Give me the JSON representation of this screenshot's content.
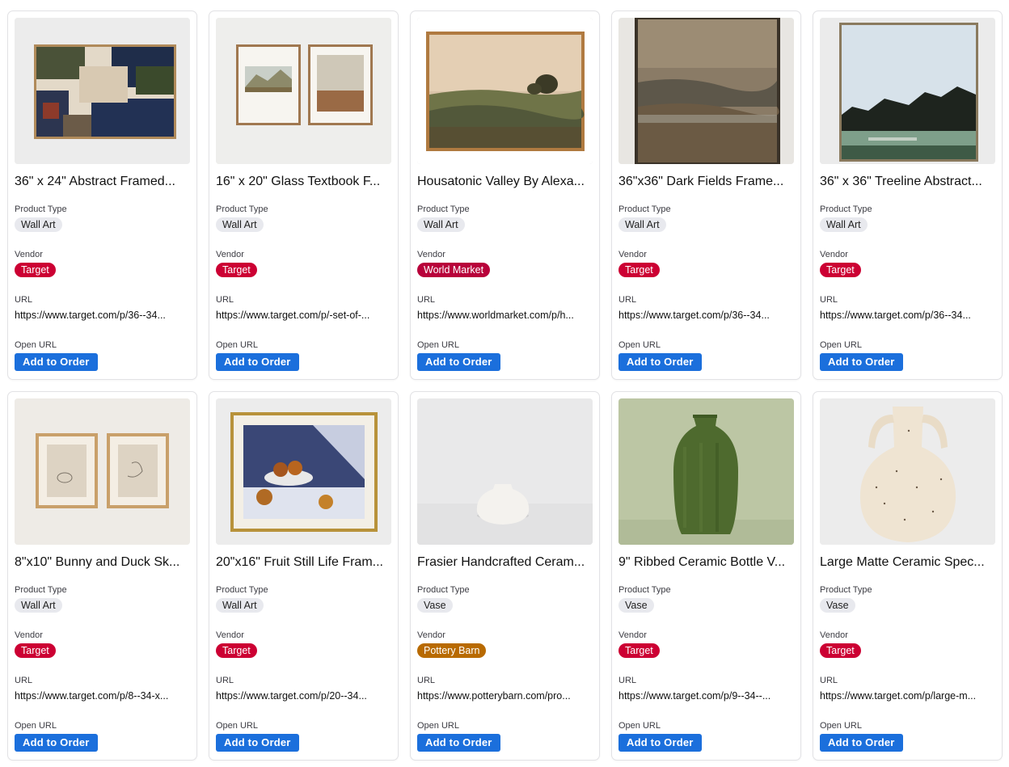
{
  "labels": {
    "product_type": "Product Type",
    "vendor": "Vendor",
    "url": "URL",
    "open_url": "Open URL",
    "add_to_order": "Add to Order"
  },
  "colors": {
    "Target": "#cc0033",
    "World Market": "#b8003a",
    "Pottery Barn": "#b86a00",
    "button": "#1b6fdc"
  },
  "products": [
    {
      "title": "36\" x 24\" Abstract Framed...",
      "type": "Wall Art",
      "vendor": "Target",
      "url": "https://www.target.com/p/36--34...",
      "image": "abstract-framed-art"
    },
    {
      "title": "16\" x 20\" Glass Textbook F...",
      "type": "Wall Art",
      "vendor": "Target",
      "url": "https://www.target.com/p/-set-of-...",
      "image": "two-framed-landscapes"
    },
    {
      "title": "Housatonic Valley By Alexa...",
      "type": "Wall Art",
      "vendor": "World Market",
      "url": "https://www.worldmarket.com/p/h...",
      "image": "landscape-painting"
    },
    {
      "title": "36\"x36\" Dark Fields Frame...",
      "type": "Wall Art",
      "vendor": "Target",
      "url": "https://www.target.com/p/36--34...",
      "image": "dark-fields-painting"
    },
    {
      "title": "36\" x 36\" Treeline Abstract...",
      "type": "Wall Art",
      "vendor": "Target",
      "url": "https://www.target.com/p/36--34...",
      "image": "treeline-abstract-painting"
    },
    {
      "title": "8\"x10\" Bunny and Duck Sk...",
      "type": "Wall Art",
      "vendor": "Target",
      "url": "https://www.target.com/p/8--34-x...",
      "image": "bunny-duck-sketches"
    },
    {
      "title": "20\"x16\" Fruit Still Life Fram...",
      "type": "Wall Art",
      "vendor": "Target",
      "url": "https://www.target.com/p/20--34...",
      "image": "fruit-still-life"
    },
    {
      "title": "Frasier Handcrafted Ceram...",
      "type": "Vase",
      "vendor": "Pottery Barn",
      "url": "https://www.potterybarn.com/pro...",
      "image": "white-ceramic-vase"
    },
    {
      "title": "9\" Ribbed Ceramic Bottle V...",
      "type": "Vase",
      "vendor": "Target",
      "url": "https://www.target.com/p/9--34--...",
      "image": "green-ribbed-vase"
    },
    {
      "title": "Large Matte Ceramic Spec...",
      "type": "Vase",
      "vendor": "Target",
      "url": "https://www.target.com/p/large-m...",
      "image": "speckled-ceramic-vase"
    }
  ]
}
